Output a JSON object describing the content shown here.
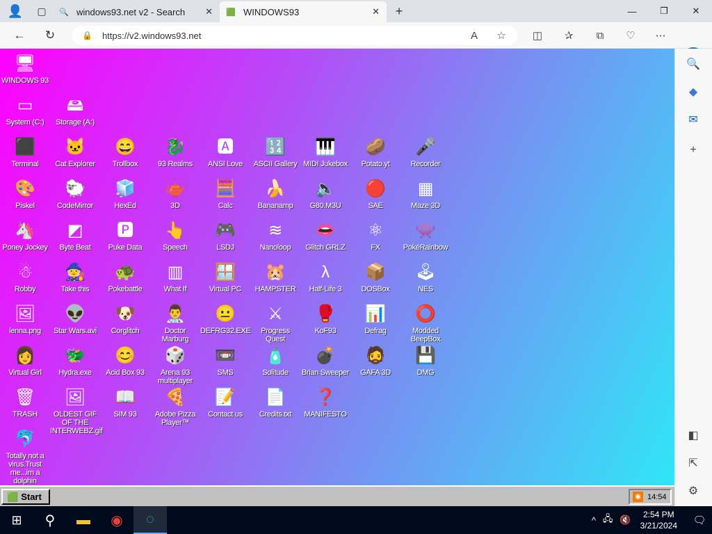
{
  "browser": {
    "tabs": [
      {
        "title": "windows93.net v2 - Search",
        "active": false
      },
      {
        "title": "WINDOWS93",
        "active": true
      }
    ],
    "url": "https://v2.windows93.net",
    "accent": "#1a6fd1"
  },
  "desktop": {
    "gradient": [
      "#ff00ff",
      "#b44cf7",
      "#7a8cf2",
      "#2fe6f7"
    ],
    "icons": [
      {
        "label": "WINDOWS 93",
        "glyph": "🖥"
      },
      {
        "label": "System (C:)",
        "glyph": "▭"
      },
      {
        "label": "Storage (A:)",
        "glyph": "🖴"
      },
      {
        "label": "Terminal",
        "glyph": "⬛"
      },
      {
        "label": "Cat Explorer",
        "glyph": "🐱"
      },
      {
        "label": "Trollbox",
        "glyph": "😄"
      },
      {
        "label": "93 Realms",
        "glyph": "🐉"
      },
      {
        "label": "ANSI Love",
        "glyph": "🅰"
      },
      {
        "label": "ASCII Gallery",
        "glyph": "🔢"
      },
      {
        "label": "MIDI Jukebox",
        "glyph": "🎹"
      },
      {
        "label": "Potato.yt",
        "glyph": "🥔"
      },
      {
        "label": "Recorder",
        "glyph": "🎤"
      },
      {
        "label": "Piskel",
        "glyph": "🎨"
      },
      {
        "label": "CodeMirror",
        "glyph": "🐑"
      },
      {
        "label": "HexEd",
        "glyph": "🧊"
      },
      {
        "label": "3D",
        "glyph": "🫖"
      },
      {
        "label": "Calc",
        "glyph": "🧮"
      },
      {
        "label": "Bananamp",
        "glyph": "🍌"
      },
      {
        "label": "G80.M3U",
        "glyph": "🔈"
      },
      {
        "label": "SAE",
        "glyph": "🔴"
      },
      {
        "label": "Maze 3D",
        "glyph": "▦"
      },
      {
        "label": "Poney Jockey",
        "glyph": "🦄"
      },
      {
        "label": "Byte Beat",
        "glyph": "◩"
      },
      {
        "label": "Puke Data",
        "glyph": "🅿"
      },
      {
        "label": "Speech",
        "glyph": "👆"
      },
      {
        "label": "LSDJ",
        "glyph": "🎮"
      },
      {
        "label": "Nanoloop",
        "glyph": "≋"
      },
      {
        "label": "Glitch GRLZ",
        "glyph": "👄"
      },
      {
        "label": "FX",
        "glyph": "⚛"
      },
      {
        "label": "PokéRainbow",
        "glyph": "👾"
      },
      {
        "label": "Robby",
        "glyph": "☃"
      },
      {
        "label": "Take this",
        "glyph": "🧙"
      },
      {
        "label": "Pokebattle",
        "glyph": "🐢"
      },
      {
        "label": "What If",
        "glyph": "▥"
      },
      {
        "label": "Virtual PC",
        "glyph": "🪟"
      },
      {
        "label": "HAMPSTER",
        "glyph": "🐹"
      },
      {
        "label": "Half-Life 3",
        "glyph": "λ"
      },
      {
        "label": "DOSBox",
        "glyph": "📦"
      },
      {
        "label": "NES",
        "glyph": "🕹"
      },
      {
        "label": "lenna.png",
        "glyph": "🖼"
      },
      {
        "label": "Star Wars.avi",
        "glyph": "👽"
      },
      {
        "label": "Corglitch",
        "glyph": "🐶"
      },
      {
        "label": "Doctor Marburg",
        "glyph": "👨‍⚕️"
      },
      {
        "label": "DEFRG32.EXE",
        "glyph": "😐"
      },
      {
        "label": "Progress Quest",
        "glyph": "⚔"
      },
      {
        "label": "KoF93",
        "glyph": "🥊"
      },
      {
        "label": "Defrag",
        "glyph": "📊"
      },
      {
        "label": "Modded BeepBox",
        "glyph": "⭕"
      },
      {
        "label": "Virtual Girl",
        "glyph": "👩"
      },
      {
        "label": "Hydra.exe",
        "glyph": "🐲"
      },
      {
        "label": "Acid Box 93",
        "glyph": "😊"
      },
      {
        "label": "Arena 93 multiplayer",
        "glyph": "🎲"
      },
      {
        "label": "SMS",
        "glyph": "📼"
      },
      {
        "label": "Solitude",
        "glyph": "🧴"
      },
      {
        "label": "Brian Sweeper",
        "glyph": "💣"
      },
      {
        "label": "GAFA 3D",
        "glyph": "🧔"
      },
      {
        "label": "DMG",
        "glyph": "💾"
      },
      {
        "label": "TRASH",
        "glyph": "🗑"
      },
      {
        "label": "OLDEST GIF OF THE INTERWEBZ.gif",
        "glyph": "🖼"
      },
      {
        "label": "SIM 93",
        "glyph": "📖"
      },
      {
        "label": "Adobe Pizza Player™",
        "glyph": "🍕"
      },
      {
        "label": "Contact us",
        "glyph": "📝"
      },
      {
        "label": "Credits.txt",
        "glyph": "📄"
      },
      {
        "label": "MANIFESTO",
        "glyph": "❓"
      },
      {
        "label": "Totally not a virus.Trust me...im a dolphin",
        "glyph": "🐬"
      }
    ]
  },
  "w93taskbar": {
    "start_label": "Start",
    "clock": "14:54"
  },
  "os_taskbar": {
    "time": "2:54 PM",
    "date": "3/21/2024"
  }
}
